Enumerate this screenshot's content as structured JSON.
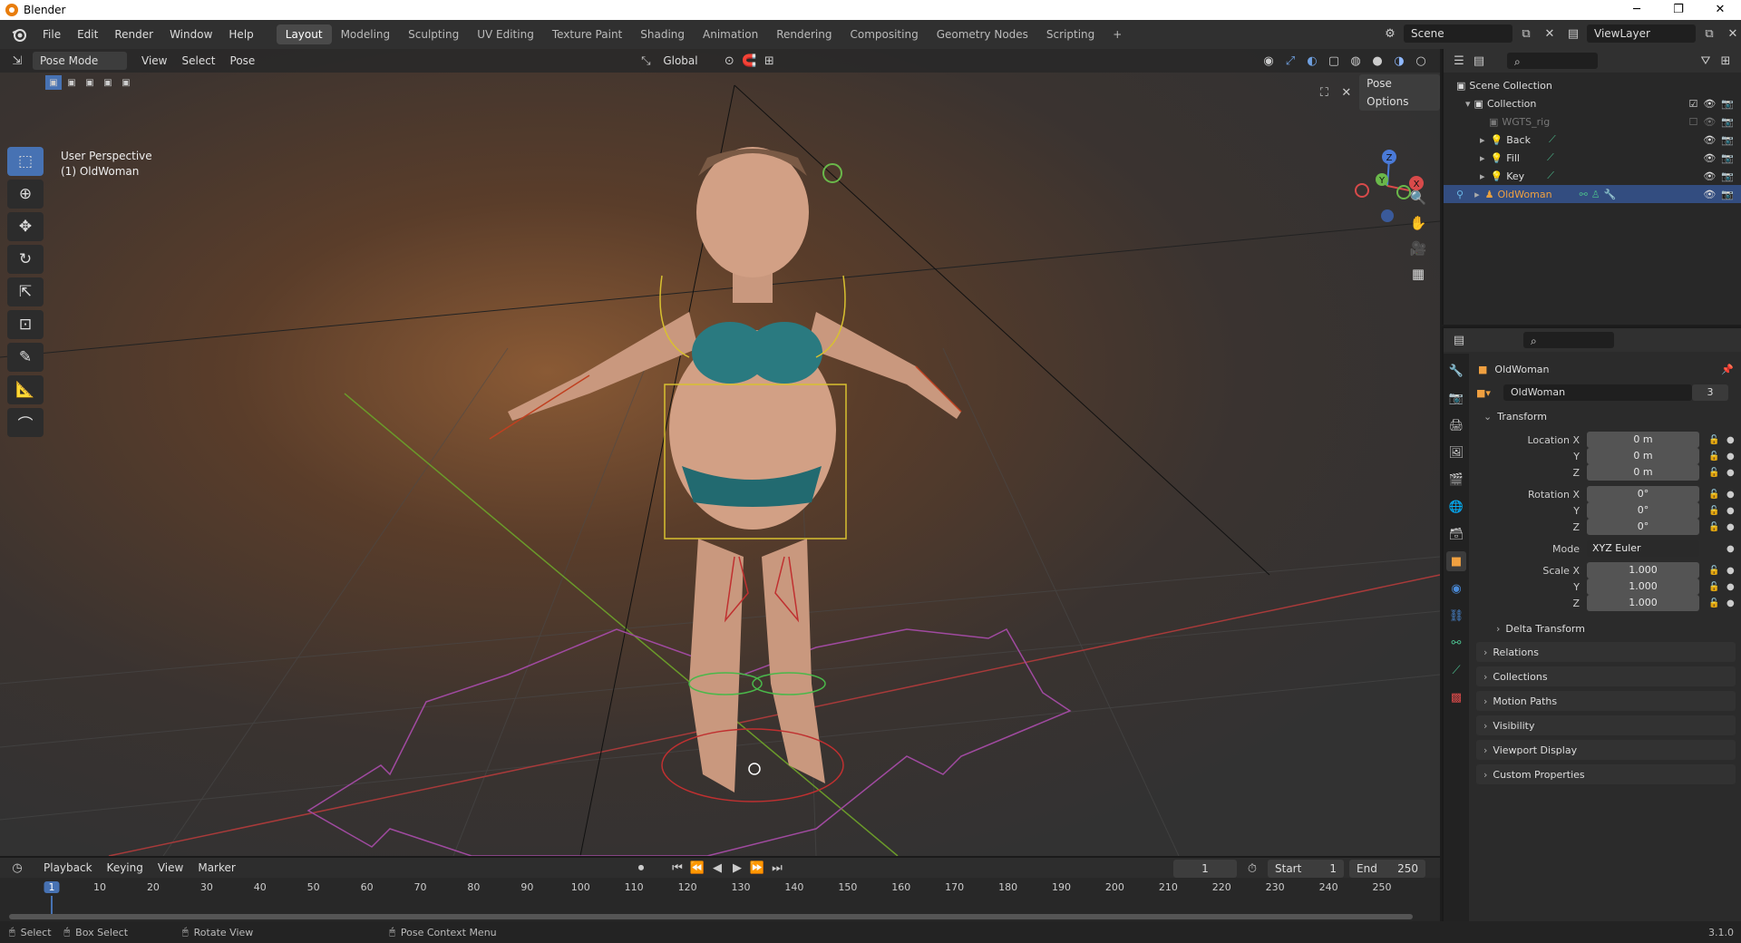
{
  "window": {
    "title": "Blender",
    "controls": [
      "─",
      "❐",
      "✕"
    ]
  },
  "menu": [
    "File",
    "Edit",
    "Render",
    "Window",
    "Help"
  ],
  "workspaces": [
    "Layout",
    "Modeling",
    "Sculpting",
    "UV Editing",
    "Texture Paint",
    "Shading",
    "Animation",
    "Rendering",
    "Compositing",
    "Geometry Nodes",
    "Scripting",
    "+"
  ],
  "scene": {
    "label": "Scene",
    "view_layer": "ViewLayer"
  },
  "viewport": {
    "mode": "Pose Mode",
    "menus": [
      "View",
      "Select",
      "Pose"
    ],
    "orientation": "Global",
    "pose_options": "Pose Options",
    "info_line1": "User Perspective",
    "info_line2": "(1) OldWoman"
  },
  "gizmo": {
    "z": "Z",
    "y": "Y",
    "x": "X"
  },
  "outliner": {
    "search_placeholder": "",
    "root": "Scene Collection",
    "collection": "Collection",
    "items": [
      "WGTS_rig",
      "Back",
      "Fill",
      "Key",
      "OldWoman"
    ]
  },
  "properties": {
    "object_name": "OldWoman",
    "datablock_name": "OldWoman",
    "users": "3",
    "transform_label": "Transform",
    "location_label": "Location X",
    "location": [
      "0 m",
      "0 m",
      "0 m"
    ],
    "rotation_label": "Rotation X",
    "rotation": [
      "0°",
      "0°",
      "0°"
    ],
    "mode_label": "Mode",
    "mode_value": "XYZ Euler",
    "scale_label": "Scale X",
    "scale": [
      "1.000",
      "1.000",
      "1.000"
    ],
    "axis_y": "Y",
    "axis_z": "Z",
    "delta_transform": "Delta Transform",
    "panels": [
      "Relations",
      "Collections",
      "Motion Paths",
      "Visibility",
      "Viewport Display",
      "Custom Properties"
    ]
  },
  "timeline": {
    "menus": [
      "Playback",
      "Keying",
      "View",
      "Marker"
    ],
    "current_frame": "1",
    "start_label": "Start",
    "start": "1",
    "end_label": "End",
    "end": "250",
    "ruler": [
      "1",
      "10",
      "20",
      "30",
      "40",
      "50",
      "60",
      "70",
      "80",
      "90",
      "100",
      "110",
      "120",
      "130",
      "140",
      "150",
      "160",
      "170",
      "180",
      "190",
      "200",
      "210",
      "220",
      "230",
      "240",
      "250"
    ]
  },
  "statusbar": {
    "select": "Select",
    "box_select": "Box Select",
    "rotate_view": "Rotate View",
    "context_menu": "Pose Context Menu",
    "version": "3.1.0"
  }
}
